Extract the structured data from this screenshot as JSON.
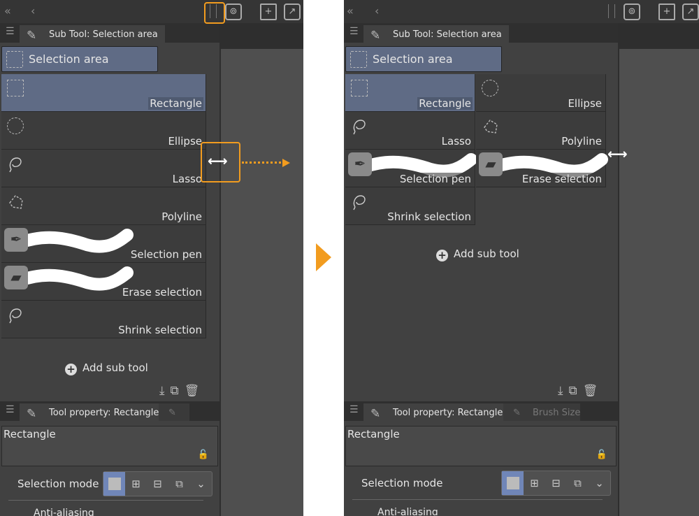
{
  "accent_color": "#f29c1f",
  "selected_color": "#5f6b85",
  "before": {
    "subtool_tab": "Sub Tool: Selection area",
    "group": "Selection area",
    "items": [
      {
        "label": "Rectangle",
        "icon": "rectangle-selection-icon",
        "selected": true
      },
      {
        "label": "Ellipse",
        "icon": "ellipse-selection-icon"
      },
      {
        "label": "Lasso",
        "icon": "lasso-icon"
      },
      {
        "label": "Polyline",
        "icon": "polyline-icon"
      },
      {
        "label": "Selection pen",
        "icon": "selection-pen-icon"
      },
      {
        "label": "Erase selection",
        "icon": "eraser-icon"
      },
      {
        "label": "Shrink selection",
        "icon": "lasso-icon"
      }
    ],
    "add_sub_tool": "Add sub tool",
    "property_tab": "Tool property: Rectangle",
    "property_name": "Rectangle",
    "selection_mode": "Selection mode",
    "last_row": "Anti-aliasing"
  },
  "after": {
    "subtool_tab": "Sub Tool: Selection area",
    "group": "Selection area",
    "items": [
      {
        "label": "Rectangle",
        "icon": "rectangle-selection-icon",
        "selected": true
      },
      {
        "label": "Ellipse",
        "icon": "ellipse-selection-icon"
      },
      {
        "label": "Lasso",
        "icon": "lasso-icon"
      },
      {
        "label": "Polyline",
        "icon": "polyline-icon"
      },
      {
        "label": "Selection pen",
        "icon": "selection-pen-icon"
      },
      {
        "label": "Erase selection",
        "icon": "eraser-icon"
      },
      {
        "label": "Shrink selection",
        "icon": "lasso-icon"
      }
    ],
    "add_sub_tool": "Add sub tool",
    "property_tab": "Tool property: Rectangle",
    "property_tab2": "Brush Size",
    "property_name": "Rectangle",
    "selection_mode": "Selection mode",
    "last_row": "Anti-aliasing"
  }
}
